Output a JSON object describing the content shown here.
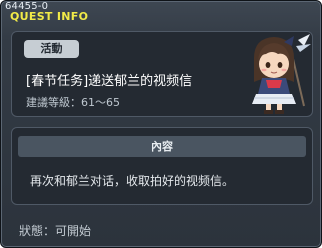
{
  "window": {
    "quest_id": "64455-0",
    "title": "QUEST INFO"
  },
  "quest": {
    "category": "活動",
    "name": "[春节任务]递送郁兰的视频信",
    "level": "建議等級：61～65",
    "npc_icon": "npc-portrait-girl"
  },
  "content": {
    "header": "內容",
    "text": "再次和郁兰对话，收取拍好的视频信。"
  },
  "status": "狀態：可開始",
  "colors": {
    "title": "#f1ea48",
    "panel_bg": "#2c333c",
    "card_bg": "#242a32",
    "badge_bg": "#c6cdd3"
  }
}
